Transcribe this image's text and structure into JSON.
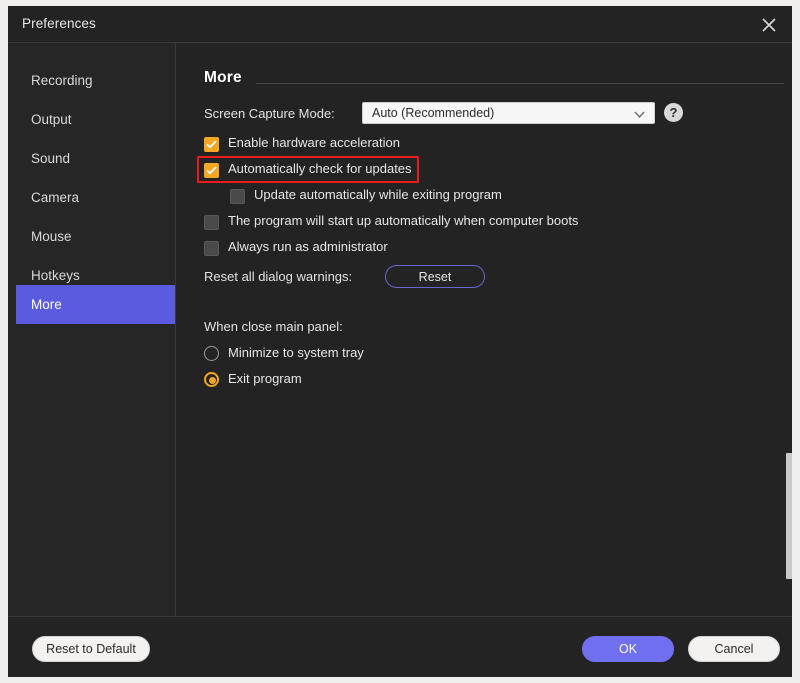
{
  "window": {
    "title": "Preferences",
    "close_icon": "close-icon"
  },
  "sidebar": {
    "items": [
      {
        "label": "Recording",
        "active": false
      },
      {
        "label": "Output",
        "active": false
      },
      {
        "label": "Sound",
        "active": false
      },
      {
        "label": "Camera",
        "active": false
      },
      {
        "label": "Mouse",
        "active": false
      },
      {
        "label": "Hotkeys",
        "active": false
      },
      {
        "label": "More",
        "active": true
      }
    ]
  },
  "main": {
    "section_title": "More",
    "capture_mode": {
      "label": "Screen Capture Mode:",
      "value": "Auto (Recommended)",
      "caret_icon": "chevron-down-icon",
      "help_icon": "help-icon",
      "help_glyph": "?"
    },
    "checkboxes": [
      {
        "label": "Enable hardware acceleration",
        "checked": true,
        "indent": false
      },
      {
        "label": "Automatically check for updates",
        "checked": true,
        "indent": false,
        "highlighted": true
      },
      {
        "label": "Update automatically while exiting program",
        "checked": false,
        "indent": true
      },
      {
        "label": "The program will start up automatically when computer boots",
        "checked": false,
        "indent": false
      },
      {
        "label": "Always run as administrator",
        "checked": false,
        "indent": false
      }
    ],
    "reset_warnings": {
      "label": "Reset all dialog warnings:",
      "button_label": "Reset"
    },
    "close_panel": {
      "label": "When close main panel:",
      "options": [
        {
          "label": "Minimize to system tray",
          "selected": false
        },
        {
          "label": "Exit program",
          "selected": true
        }
      ]
    }
  },
  "footer": {
    "reset_default_label": "Reset to Default",
    "ok_label": "OK",
    "cancel_label": "Cancel"
  },
  "colors": {
    "accent_selected": "#5b5be0",
    "checkbox_on": "#f5a623",
    "primary_button": "#6f6ff0",
    "annotation": "#ee1b1b"
  }
}
